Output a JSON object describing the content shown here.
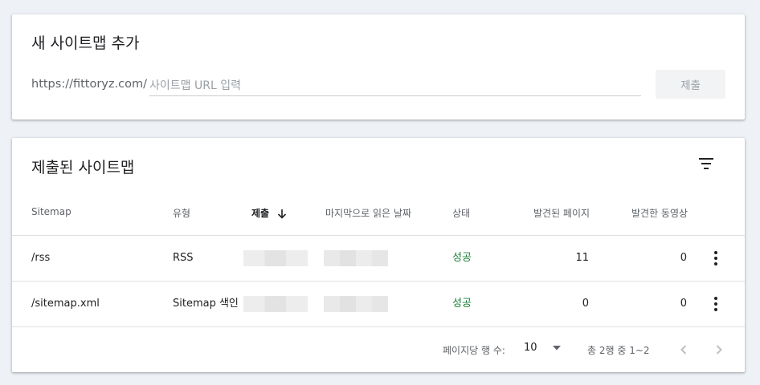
{
  "add_sitemap": {
    "title": "새 사이트맵 추가",
    "url_prefix": "https://fittoryz.com/",
    "input_placeholder": "사이트맵 URL 입력",
    "input_value": "",
    "submit_label": "제출"
  },
  "submitted": {
    "title": "제출된 사이트맵",
    "columns": {
      "sitemap": "Sitemap",
      "type": "유형",
      "submitted": "제출",
      "last_read": "마지막으로 읽은 날짜",
      "status": "상태",
      "pages_found": "발견된 페이지",
      "videos_found": "발견한 동영상"
    },
    "rows": [
      {
        "sitemap": "/rss",
        "type": "RSS",
        "status": "성공",
        "pages": "11",
        "videos": "0"
      },
      {
        "sitemap": "/sitemap.xml",
        "type": "Sitemap 색인",
        "status": "성공",
        "pages": "0",
        "videos": "0"
      }
    ],
    "pagination": {
      "rows_per_page_label": "페이지당 행 수:",
      "rows_per_page_value": "10",
      "range_text": "총 2행 중 1~2"
    }
  },
  "colors": {
    "status_success": "#188038",
    "background": "#eef1f6"
  },
  "icons": [
    "filter-icon",
    "arrow-down-icon",
    "more-vert-icon",
    "dropdown-arrow-icon",
    "chevron-left-icon",
    "chevron-right-icon"
  ]
}
